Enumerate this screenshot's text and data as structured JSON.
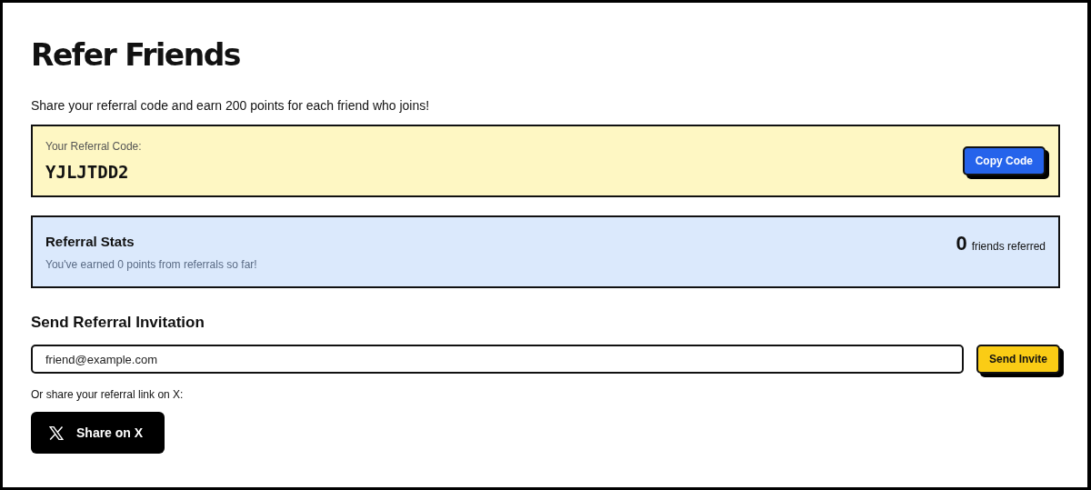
{
  "title": "Refer Friends",
  "intro": "Share your referral code and earn 200 points for each friend who joins!",
  "referral_code": {
    "label": "Your Referral Code:",
    "code": "YJLJTDD2",
    "button": "Copy Code"
  },
  "stats": {
    "title": "Referral Stats",
    "note": "You've earned 0 points from referrals so far!",
    "count": "0",
    "count_label": "friends referred"
  },
  "invite": {
    "heading": "Send Referral Invitation",
    "email": "friend@example.com",
    "button": "Send Invite"
  },
  "share": {
    "label": "Or share your referral link on X:",
    "button": "Share on X"
  }
}
